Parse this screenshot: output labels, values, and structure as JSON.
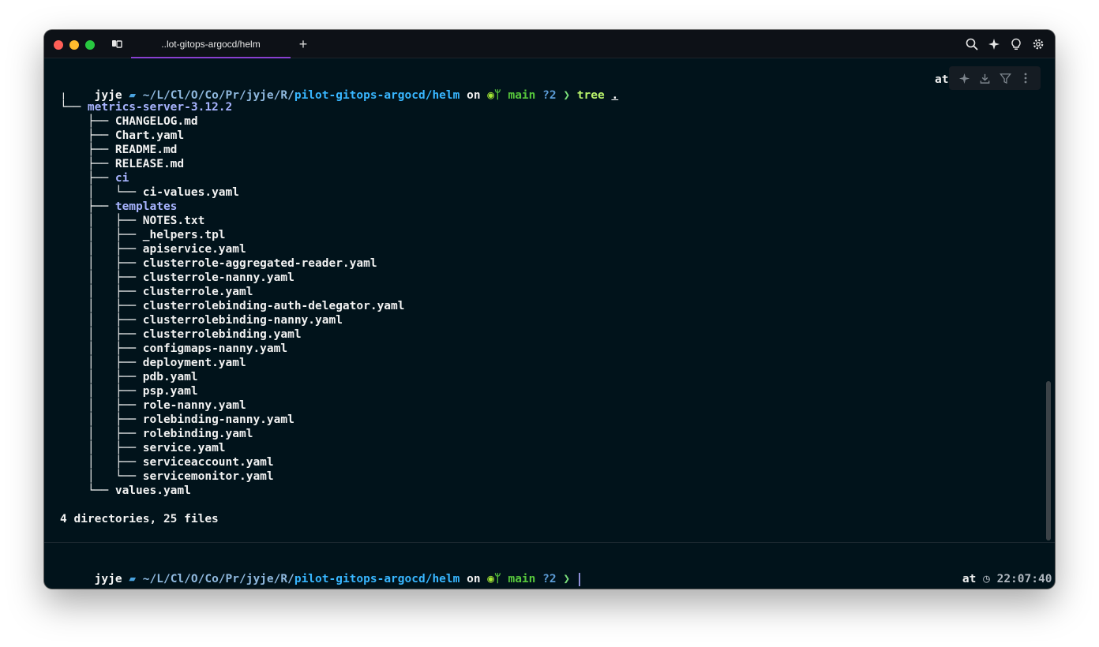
{
  "window": {
    "tab_title": "..lot-gitops-argocd/helm",
    "new_tab_label": "+",
    "toolbar_icons": [
      "search-icon",
      "ai-sparkle-icon",
      "lightbulb-icon",
      "settings-icon"
    ]
  },
  "command_prompt": {
    "user": "jyje",
    "path_dim": "~/L/Cl/O/Co/Pr/jyje/R/",
    "path_bold": "pilot-gitops-argocd/helm",
    "on": "on",
    "branch": "main",
    "status": "?2",
    "chevron": "❯",
    "command": "tree",
    "arg": ".",
    "right_partial": "at"
  },
  "block_toolbar_icons": [
    "ai-sparkle-icon",
    "download-icon",
    "filter-icon",
    "more-icon"
  ],
  "tree": {
    "top_marker": "╵",
    "lines": [
      {
        "prefix": "└── ",
        "name": "metrics-server-3.12.2",
        "dir": true
      },
      {
        "prefix": "    ├── ",
        "name": "CHANGELOG.md",
        "dir": false
      },
      {
        "prefix": "    ├── ",
        "name": "Chart.yaml",
        "dir": false
      },
      {
        "prefix": "    ├── ",
        "name": "README.md",
        "dir": false
      },
      {
        "prefix": "    ├── ",
        "name": "RELEASE.md",
        "dir": false
      },
      {
        "prefix": "    ├── ",
        "name": "ci",
        "dir": true
      },
      {
        "prefix": "    │   └── ",
        "name": "ci-values.yaml",
        "dir": false
      },
      {
        "prefix": "    ├── ",
        "name": "templates",
        "dir": true
      },
      {
        "prefix": "    │   ├── ",
        "name": "NOTES.txt",
        "dir": false
      },
      {
        "prefix": "    │   ├── ",
        "name": "_helpers.tpl",
        "dir": false
      },
      {
        "prefix": "    │   ├── ",
        "name": "apiservice.yaml",
        "dir": false
      },
      {
        "prefix": "    │   ├── ",
        "name": "clusterrole-aggregated-reader.yaml",
        "dir": false
      },
      {
        "prefix": "    │   ├── ",
        "name": "clusterrole-nanny.yaml",
        "dir": false
      },
      {
        "prefix": "    │   ├── ",
        "name": "clusterrole.yaml",
        "dir": false
      },
      {
        "prefix": "    │   ├── ",
        "name": "clusterrolebinding-auth-delegator.yaml",
        "dir": false
      },
      {
        "prefix": "    │   ├── ",
        "name": "clusterrolebinding-nanny.yaml",
        "dir": false
      },
      {
        "prefix": "    │   ├── ",
        "name": "clusterrolebinding.yaml",
        "dir": false
      },
      {
        "prefix": "    │   ├── ",
        "name": "configmaps-nanny.yaml",
        "dir": false
      },
      {
        "prefix": "    │   ├── ",
        "name": "deployment.yaml",
        "dir": false
      },
      {
        "prefix": "    │   ├── ",
        "name": "pdb.yaml",
        "dir": false
      },
      {
        "prefix": "    │   ├── ",
        "name": "psp.yaml",
        "dir": false
      },
      {
        "prefix": "    │   ├── ",
        "name": "role-nanny.yaml",
        "dir": false
      },
      {
        "prefix": "    │   ├── ",
        "name": "rolebinding-nanny.yaml",
        "dir": false
      },
      {
        "prefix": "    │   ├── ",
        "name": "rolebinding.yaml",
        "dir": false
      },
      {
        "prefix": "    │   ├── ",
        "name": "service.yaml",
        "dir": false
      },
      {
        "prefix": "    │   ├── ",
        "name": "serviceaccount.yaml",
        "dir": false
      },
      {
        "prefix": "    │   └── ",
        "name": "servicemonitor.yaml",
        "dir": false
      },
      {
        "prefix": "    └── ",
        "name": "values.yaml",
        "dir": false
      }
    ],
    "summary": "4 directories, 25 files"
  },
  "input_prompt": {
    "user": "jyje",
    "path_dim": "~/L/Cl/O/Co/Pr/jyje/R/",
    "path_bold": "pilot-gitops-argocd/helm",
    "on": "on",
    "branch": "main",
    "status": "?2",
    "chevron": "❯",
    "at": "at",
    "time": "22:07:40"
  }
}
